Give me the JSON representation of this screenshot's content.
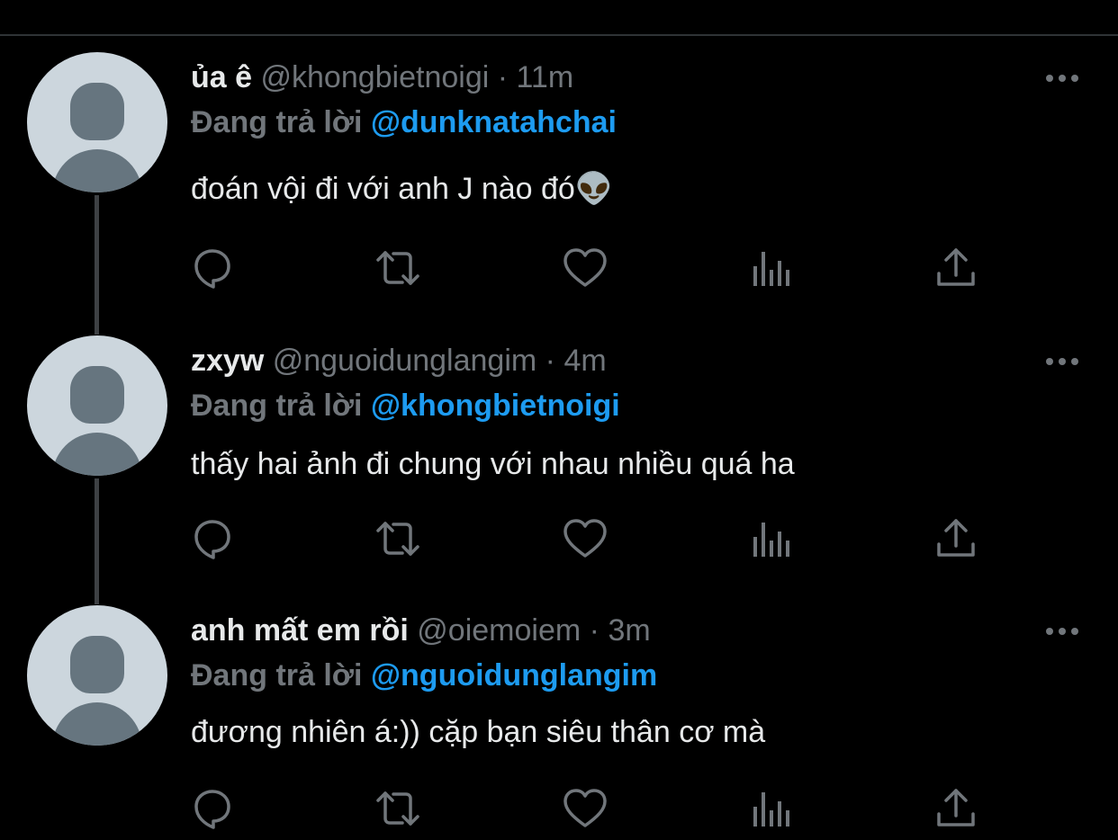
{
  "tweets": [
    {
      "name": "ủa ê",
      "handle": "@khongbietnoigi",
      "time": "11m",
      "replying_label": "Đang trả lời",
      "replying_to": "@dunknatahchai",
      "text": "đoán vội đi với anh J nào đó👽"
    },
    {
      "name": "zxyw",
      "handle": "@nguoidunglangim",
      "time": "4m",
      "replying_label": "Đang trả lời",
      "replying_to": "@khongbietnoigi",
      "text": "thấy hai ảnh đi chung với nhau nhiều quá ha"
    },
    {
      "name": "anh mất em rồi",
      "handle": "@oiemoiem",
      "time": "3m",
      "replying_label": "Đang trả lời",
      "replying_to": "@nguoidunglangim",
      "text": "đương nhiên á:)) cặp bạn siêu thân cơ mà"
    }
  ],
  "separator": "·",
  "icons": [
    "reply-icon",
    "retweet-icon",
    "like-icon",
    "analytics-icon",
    "share-icon",
    "more-icon"
  ],
  "colors": {
    "background": "#000000",
    "text": "#e7e9ea",
    "muted": "#71767b",
    "mention": "#1d9bf0",
    "avatar_bg": "#ccd6dd",
    "avatar_fg": "#66757f"
  }
}
